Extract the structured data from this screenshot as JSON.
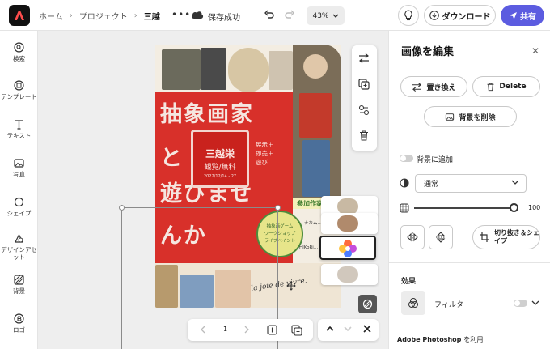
{
  "topbar": {
    "breadcrumb": [
      "ホーム",
      "プロジェクト",
      "三越"
    ],
    "more": "•••",
    "save_status": "保存成功",
    "zoom": "43%",
    "download_label": "ダウンロード",
    "share_label": "共有"
  },
  "rail": {
    "items": [
      {
        "label": "検索",
        "icon": "search-icon"
      },
      {
        "label": "テンプレート",
        "icon": "template-icon"
      },
      {
        "label": "テキスト",
        "icon": "text-icon"
      },
      {
        "label": "写真",
        "icon": "photo-icon"
      },
      {
        "label": "シェイプ",
        "icon": "shape-icon"
      },
      {
        "label": "デザインアセット",
        "icon": "design-assets-icon"
      },
      {
        "label": "背景",
        "icon": "background-icon"
      },
      {
        "label": "ロゴ",
        "icon": "logo-icon"
      }
    ]
  },
  "poster": {
    "kanji_top": "抽象画家",
    "kanji_mid": "と",
    "kanji_bottom": "遊びませ",
    "kanji_last": "んか",
    "seal_title": "三越栄",
    "seal_sub": "観覧/無料",
    "seal_date": "2022/12/14 - 27",
    "side_text": [
      "展示＋",
      "即売＋",
      "遊び"
    ],
    "badge_lines": [
      "抽象画ゲーム",
      "ワークショップ",
      "ライブペイント"
    ],
    "sanka": "参加作家",
    "artist_1": "ナカム…",
    "artist_2": "HIKoRi…",
    "joie": "la joie de vivre."
  },
  "pager": {
    "page": "1"
  },
  "panel": {
    "title": "画像を編集",
    "replace_label": "置き換え",
    "delete_label": "Delete",
    "remove_bg_label": "背景を削除",
    "bg_add_label": "背景に追加",
    "blend_mode": "通常",
    "opacity": "100",
    "opacity_fraction": 1.0,
    "crop_label_1": "切り抜き＆シェ",
    "crop_label_2": "イプ",
    "effects_label": "効果",
    "filter_label": "フィルター",
    "footer_brand": "Adobe Photoshop",
    "footer_text": "を利用"
  },
  "colors": {
    "accent": "#5c5ce0",
    "poster_red": "#d8302a"
  }
}
